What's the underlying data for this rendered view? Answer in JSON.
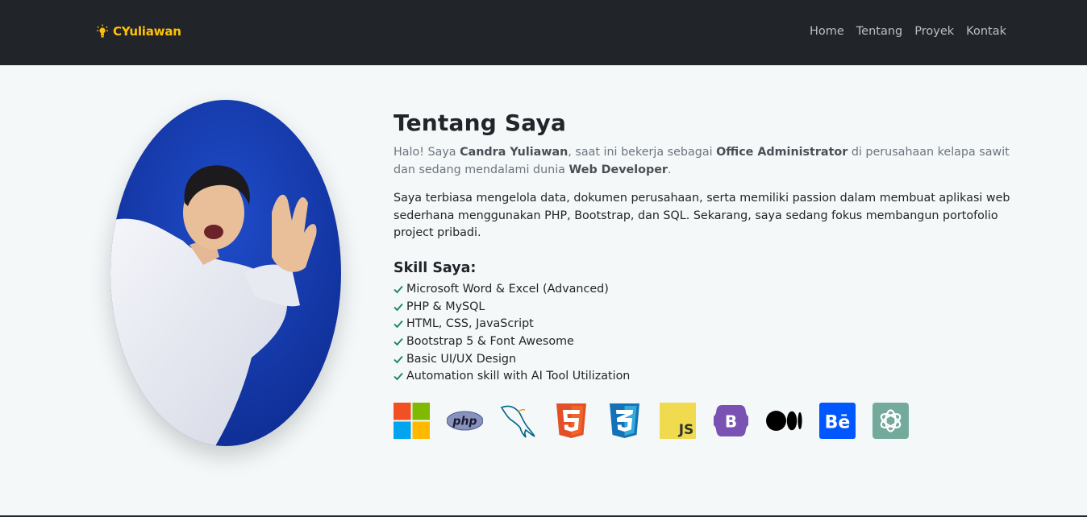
{
  "brand": {
    "name": "CYuliawan",
    "icon": "lightbulb-icon",
    "color": "#ffc107"
  },
  "nav": {
    "items": [
      "Home",
      "Tentang",
      "Proyek",
      "Kontak"
    ]
  },
  "about": {
    "title": "Tentang Saya",
    "intro": {
      "t1": "Halo! Saya ",
      "name": "Candra Yuliawan",
      "t2": ", saat ini bekerja sebagai ",
      "job": "Office Administrator",
      "t3": " di perusahaan kelapa sawit dan sedang mendalami dunia ",
      "field": "Web Developer",
      "t4": "."
    },
    "paragraph": "Saya terbiasa mengelola data, dokumen perusahaan, serta memiliki passion dalam membuat aplikasi web sederhana menggunakan PHP, Bootstrap, dan SQL. Sekarang, saya sedang fokus membangun portofolio project pribadi.",
    "skill_title": "Skill Saya:",
    "skills": [
      "Microsoft Word & Excel (Advanced)",
      "PHP & MySQL",
      "HTML, CSS, JavaScript",
      "Bootstrap 5 & Font Awesome",
      "Basic UI/UX Design",
      "Automation skill with AI Tool Utilization"
    ],
    "tech_icons": [
      "microsoft-icon",
      "php-icon",
      "mysql-icon",
      "html5-icon",
      "css3-icon",
      "javascript-icon",
      "bootstrap-icon",
      "medium-icon",
      "behance-icon",
      "chatgpt-icon"
    ],
    "php_logo_text": "php",
    "js_logo_text": "JS",
    "bootstrap_logo_text": "B",
    "behance_logo_text": "Bē"
  },
  "colors": {
    "navbar": "#212529",
    "check": "#198754",
    "page_bg": "#f4f8f9"
  }
}
